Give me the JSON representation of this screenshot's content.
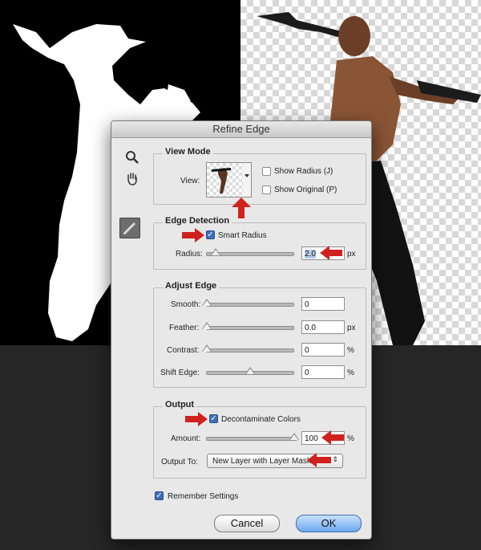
{
  "dialog": {
    "title": "Refine Edge",
    "view_mode": {
      "title": "View Mode",
      "view_label": "View:",
      "show_radius": "Show Radius (J)",
      "show_original": "Show Original (P)"
    },
    "edge_detection": {
      "title": "Edge Detection",
      "smart_radius": "Smart Radius",
      "radius_label": "Radius:",
      "radius_value": "2.0",
      "radius_unit": "px"
    },
    "adjust_edge": {
      "title": "Adjust Edge",
      "smooth_label": "Smooth:",
      "smooth_value": "0",
      "feather_label": "Feather:",
      "feather_value": "0.0",
      "feather_unit": "px",
      "contrast_label": "Contrast:",
      "contrast_value": "0",
      "contrast_unit": "%",
      "shift_label": "Shift Edge:",
      "shift_value": "0",
      "shift_unit": "%"
    },
    "output": {
      "title": "Output",
      "decontaminate": "Decontaminate Colors",
      "amount_label": "Amount:",
      "amount_value": "100",
      "amount_unit": "%",
      "output_to_label": "Output To:",
      "output_to_value": "New Layer with Layer Mask"
    },
    "remember": "Remember Settings",
    "cancel": "Cancel",
    "ok": "OK"
  },
  "colors": {
    "accent": "#3d6fb7",
    "arrow": "#d1211f"
  },
  "icons": [
    "zoom-icon",
    "hand-icon",
    "refine-radius-tool-icon",
    "chevron-down-icon"
  ]
}
